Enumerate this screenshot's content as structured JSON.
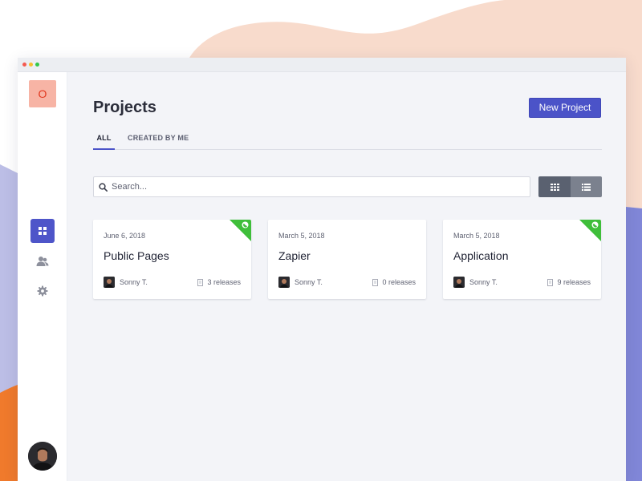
{
  "sidebar": {
    "org_initial": "O",
    "items": [
      {
        "icon": "grid-icon",
        "active": true
      },
      {
        "icon": "team-icon",
        "active": false
      },
      {
        "icon": "gear-icon",
        "active": false
      }
    ],
    "user_avatar": "avatar"
  },
  "header": {
    "title": "Projects",
    "new_project_label": "New Project"
  },
  "tabs": [
    {
      "label": "ALL",
      "active": true
    },
    {
      "label": "CREATED BY ME",
      "active": false
    }
  ],
  "search": {
    "placeholder": "Search...",
    "value": ""
  },
  "view_toggle": {
    "grid_icon": "grid-view-icon",
    "list_icon": "list-view-icon",
    "selected": "grid"
  },
  "projects": [
    {
      "date": "June 6, 2018",
      "title": "Public Pages",
      "owner": "Sonny T.",
      "releases": "3 releases",
      "published": true
    },
    {
      "date": "March 5, 2018",
      "title": "Zapier",
      "owner": "Sonny T.",
      "releases": "0 releases",
      "published": false
    },
    {
      "date": "March 5, 2018",
      "title": "Application",
      "owner": "Sonny T.",
      "releases": "9 releases",
      "published": true
    }
  ],
  "colors": {
    "accent": "#4b53c8",
    "published": "#3fbe3a",
    "logo_bg": "#f7b4a5",
    "logo_text": "#e2381f"
  }
}
